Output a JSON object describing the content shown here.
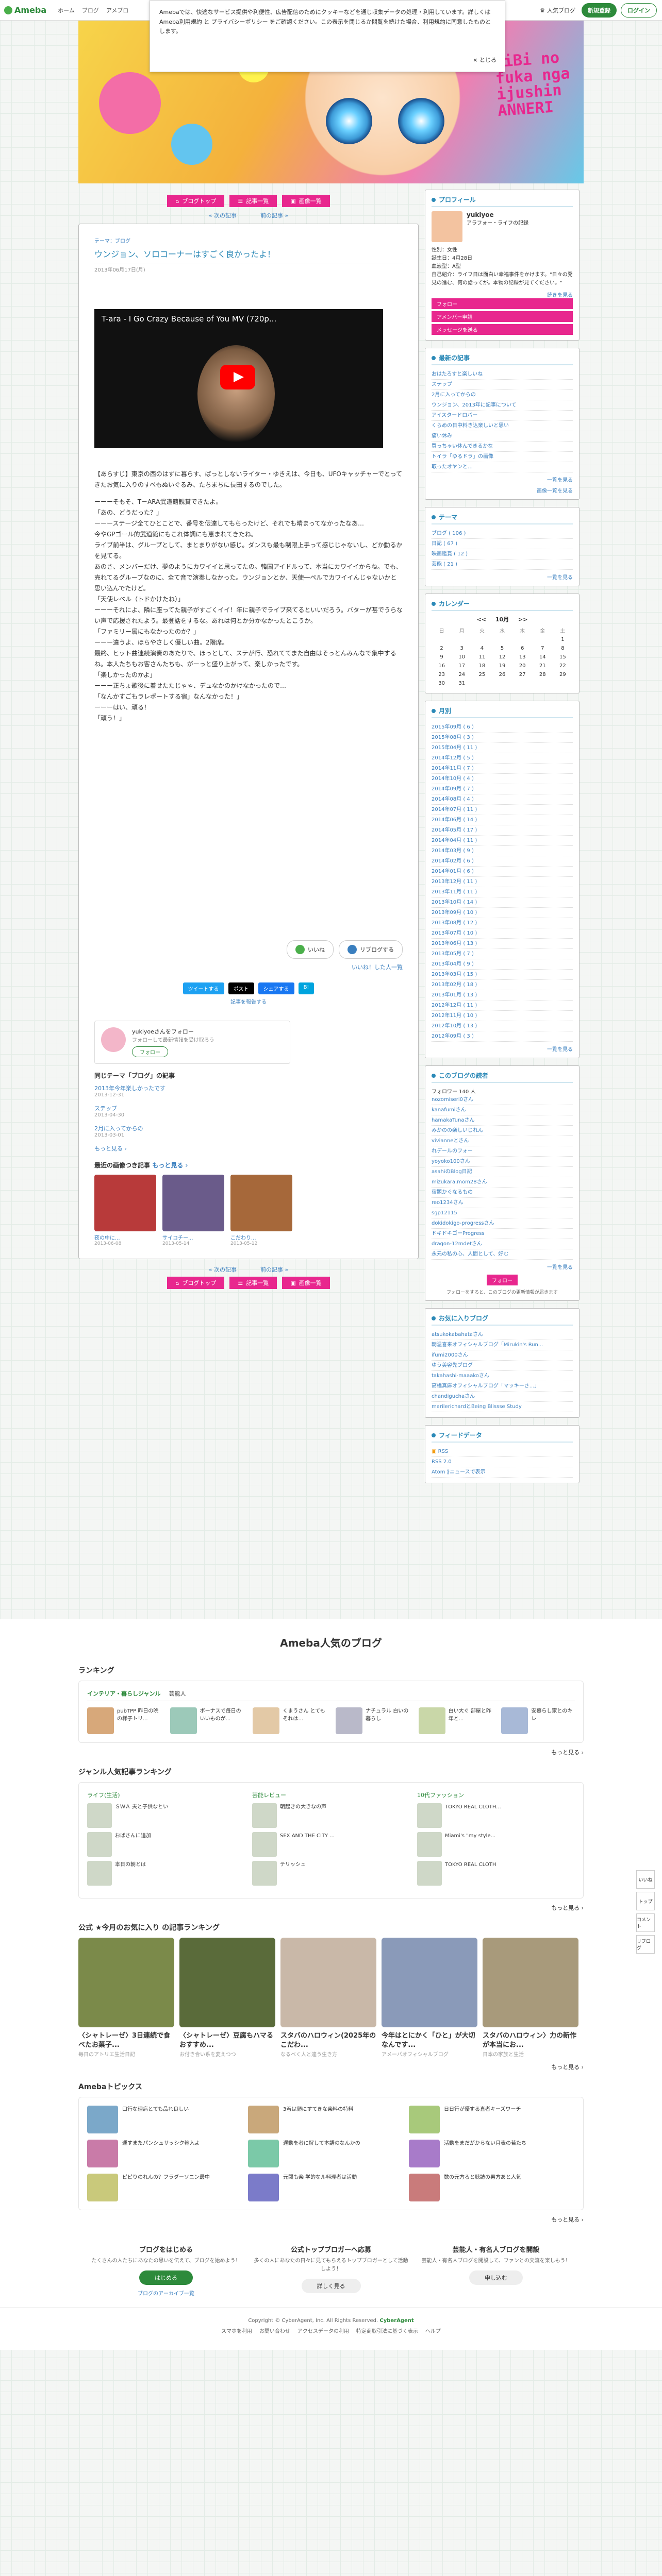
{
  "topbar": {
    "logo": "Ameba",
    "nav": [
      "ホーム",
      "ブログ",
      "アメブロ"
    ],
    "blog_link": "人気ブログ",
    "signup": "新規登録",
    "login": "ログイン"
  },
  "cookie": {
    "text": "Amebaでは、快適なサービス提供や利便性、広告配信のためにクッキーなどを通じ収集データの処理・利用しています。詳しくは Ameba利用規約 と プライバシーポリシー をご確認ください。この表示を閉じるか閲覧を続けた場合、利用規約に同意したものとします。",
    "close": "とじる"
  },
  "header": {
    "title": "HiBi no fuka nga ijushin ANNERI"
  },
  "nav_buttons": [
    "ブログトップ",
    "記事一覧",
    "画像一覧"
  ],
  "page_nav": {
    "prev": "« 次の記事",
    "next": "前の記事 »"
  },
  "article": {
    "theme": "テーマ：ブログ",
    "title": "ウンジョン、ソロコーナーはすごく良かったよ！",
    "meta": "2013年06月17日(月)",
    "video_title": "T-ara - I Go Crazy Because of You MV (720p...",
    "body": [
      "【あらすじ】東京の西のはずに暮らす、ぱっとしないライター・ゆきえは、今日も、UFOキャッチャーでとってきたお気に入りのすべもぬいぐるみ、たちまちに長田するのでした。",
      "",
      "ーーーそもそ、T－ARA武道館観賞できたよ。",
      "「あの、どうだった？」",
      "ーーーステージ全てひとことで、番号を伝達してもらったけど、それでも晴まってなかったなあ…",
      "今やGPゴール的武道館にもこれ体調にも恵まれてきたね。",
      "ライブ前半は、グループとして、まとまりがない感じ。ダンスも最も制限上手って感じじゃないし、どか動るかを見てる。",
      "あのさ、メンバーだけ、夢のようにカワイイと思ってたの。韓国アイドルって、本当にカワイイからね。でも、売れてるグループなのに、全て音で演奏しなかった。ウンジョンとか、天使一ペルでカワイイんじゃないかと思い込んでたけど。",
      "「天使レベル（トドかけたね）」",
      "ーーーそれによ、隣に座ってた親子がすごくイイ！年に親子でライブ来てるといいだろう。バターが甚でうらない声で応援されたよう。最登話をするな。あれは何とか分かなかったとこうか。",
      "「ファミリー層にもなかったのか？」",
      "ーーー違うよ、ほらやさしく優しい曲。2階席。",
      "最終、ヒット曲連続演奏のあたりで、ほっとして、ステが行、恐れててまた自由はそっとんみんなで集中するね。本人たちもお客さんたちも、がーっと盛り上がって、楽しかったです。",
      "「楽しかったのかよ」",
      "ーーー正ちょ歌後に着せたたじゃゃ、デュなかのかけなかったので…",
      "「なんかすごもラレポートする宿」なんなかった！」",
      "ーーーはい、頑る！",
      "「頑う！」"
    ],
    "like_button": "いいね",
    "reblog_button": "リブログする",
    "like_link": "いいね！した人一覧",
    "share": [
      "ツイートする",
      "ポスト",
      "シェアする",
      "B!"
    ],
    "share_sub": "記事を報告する"
  },
  "follow_card": {
    "name": "yukiyoeさんをフォロー",
    "sub": "フォローして最新情報を受け取ろう",
    "button": "フォロー"
  },
  "same_theme": {
    "heading": "同じテーマ「ブログ」の記事",
    "items": [
      {
        "title": "2013年今年楽しかったです",
        "date": "2013-12-31"
      },
      {
        "title": "ステップ",
        "date": "2013-04-30"
      },
      {
        "title": "2月に入ってからの",
        "date": "2013-03-01"
      }
    ],
    "more": "もっと見る ›"
  },
  "recent": {
    "heading": "最近の画像つき記事",
    "more": "もっと見る ›",
    "items": [
      {
        "cap": "夜の中に...",
        "date": "2013-06-08",
        "color": "#b83a3a"
      },
      {
        "cap": "サイコチー...",
        "date": "2013-05-14",
        "color": "#6a5b8a"
      },
      {
        "cap": "こだわり...",
        "date": "2013-05-12",
        "color": "#a6683a"
      }
    ]
  },
  "sidebar": {
    "profile": {
      "heading": "プロフィール",
      "name": "yukiyoe",
      "sub": "アラフォー・ライフの記録",
      "desc": "性別：女性\n誕生日：4月28日\n血液型：A型\n自己紹介：ライフ日は面白い幸福事件をかけます。\"日々の発見の進む、何の話ってが。本物の記録が見てください。\"",
      "follow": "フォロー",
      "app": "アメンバー申請",
      "message": "メッセージを送る",
      "more": "続きを見る"
    },
    "latest": {
      "heading": "最新の記事",
      "items": [
        "おはたろすと楽しいね",
        "ステップ",
        "2月に入ってからの",
        "ウンジョン、2013年に記事について",
        "アイスタードロバー",
        "くらめの日中料き込楽しいと思い",
        "痛い休み",
        "買っちゃい休んできるかな",
        "トイラ「ゆるドラ」の画像",
        "取ったオヤンと…"
      ],
      "more": "一覧を見る",
      "more2": "画像一覧を見る"
    },
    "themes": {
      "heading": "テーマ",
      "items": [
        "ブログ ( 106 )",
        "日記 ( 67 )",
        "映画鑑賞 ( 12 )",
        "芸能 ( 21 )"
      ],
      "more": "一覧を見る"
    },
    "calendar": {
      "heading": "カレンダー",
      "month": "10月",
      "days": [
        "日",
        "月",
        "火",
        "水",
        "木",
        "金",
        "土"
      ],
      "weeks": [
        [
          "",
          "",
          "",
          "",
          "",
          "",
          "1"
        ],
        [
          "2",
          "3",
          "4",
          "5",
          "6",
          "7",
          "8"
        ],
        [
          "9",
          "10",
          "11",
          "12",
          "13",
          "14",
          "15"
        ],
        [
          "16",
          "17",
          "18",
          "19",
          "20",
          "21",
          "22"
        ],
        [
          "23",
          "24",
          "25",
          "26",
          "27",
          "28",
          "29"
        ],
        [
          "30",
          "31",
          "",
          "",
          "",
          "",
          ""
        ]
      ]
    },
    "archive": {
      "heading": "月別",
      "items": [
        "2015年09月 ( 6 )",
        "2015年08月 ( 3 )",
        "2015年04月 ( 11 )",
        "2014年12月 ( 5 )",
        "2014年11月 ( 7 )",
        "2014年10月 ( 4 )",
        "2014年09月 ( 7 )",
        "2014年08月 ( 4 )",
        "2014年07月 ( 11 )",
        "2014年06月 ( 14 )",
        "2014年05月 ( 17 )",
        "2014年04月 ( 11 )",
        "2014年03月 ( 9 )",
        "2014年02月 ( 6 )",
        "2014年01月 ( 6 )",
        "2013年12月 ( 11 )",
        "2013年11月 ( 11 )",
        "2013年10月 ( 14 )",
        "2013年09月 ( 10 )",
        "2013年08月 ( 12 )",
        "2013年07月 ( 10 )",
        "2013年06月 ( 13 )",
        "2013年05月 ( 7 )",
        "2013年04月 ( 9 )",
        "2013年03月 ( 15 )",
        "2013年02月 ( 18 )",
        "2013年01月 ( 13 )",
        "2012年12月 ( 11 )",
        "2012年11月 ( 10 )",
        "2012年10月 ( 13 )",
        "2012年09月 ( 3 )"
      ],
      "more": "一覧を見る"
    },
    "readers": {
      "heading": "このブログの読者",
      "count": "フォロワー 140 人",
      "items": [
        "nozomiseri0さん",
        "kanafumiさん",
        "hamakaTunaさん",
        "みかのの楽しいじれん",
        "vivianneとさん",
        "れデールのフォー",
        "yoyoko100さん",
        "asahiのBlog日記",
        "mizukara.mom28さん",
        "宿題かぐなるもの",
        "reo1234さん",
        "sgp12115",
        "dokidokigo-progressさん",
        "ドキドキゴーProgress",
        "dragon-12mdetさん",
        "永元の私の心、人間として、好む"
      ],
      "follow": "フォロー",
      "more": "一覧を見る",
      "note": "フォローをすると、このブログの更新情報が届きます"
    },
    "favorites": {
      "heading": "お気に入りブログ",
      "items": [
        "atsukokabahataさん",
        "朝温喜来オフィシャルブログ「Mirukin's Run...",
        "ifumi2000さん",
        "ゆう美容先ブログ",
        "takahashi-maaakoさん",
        "高橋真麻オフィシャルブログ「マッキーさ...」",
        "chandiguchaさん",
        "marilerichardとBeing Blissse Study"
      ]
    },
    "feed": {
      "heading": "フィードデータ",
      "items": [
        "RSS",
        "RSS 2.0",
        "Atom  ⟫ニュースで表示"
      ]
    }
  },
  "sidetools": [
    "いいね",
    "トップ",
    "コメント",
    "リブログ"
  ],
  "popular": {
    "title": "Ameba人気のブログ",
    "ranking_heading": "ランキング",
    "tabs": [
      "インテリア・暮らしジャンル",
      "芸能人"
    ],
    "rank": [
      {
        "t": "pubTPP 昨日の晩の様子トリ...",
        "color": "#d7a87a"
      },
      {
        "t": "ボーナスで毎日のいいものが...",
        "color": "#9cc9b9"
      },
      {
        "t": "くまうさん とてもそれは…",
        "color": "#e3c9a6"
      },
      {
        "t": "ナチュラル 白いの暮らし",
        "color": "#b9b9c9"
      },
      {
        "t": "白い大ぐ 部屋と昨年と...",
        "color": "#c9d7a8"
      },
      {
        "t": "安暮らし家とのキレ",
        "color": "#a8b9d7"
      }
    ],
    "rank_more": "もっと見る ›",
    "genre_heading": "ジャンル人気記事ランキング",
    "genre_cols": [
      {
        "h": "ライフ(生活)",
        "items": [
          "ＳＷＡ\n夫と子供なとい",
          "おばさんに追加",
          "本日の朝とは"
        ]
      },
      {
        "h": "芸能レビュー",
        "items": [
          "朝起きの大きなの声",
          "SEX AND THE CITY ...",
          "テリッシュ"
        ]
      },
      {
        "h": "10代ファッション",
        "items": [
          "TOKYO REAL CLOTH...",
          "Miami's \"my style...",
          "TOKYO REAL CLOTH"
        ]
      }
    ],
    "genre_more": "もっと見る ›",
    "official_heading": "公式 ★今月のお気に入り の記事ランキング",
    "official": [
      {
        "t": "〈シャトレーゼ〉3日連続で食べたお菓子...",
        "color": "#7b8a4a",
        "s": "毎日のアトリエ生活日記"
      },
      {
        "t": "〈シャトレーゼ〉豆腐もハマるおすすめ...",
        "color": "#5a6b3a",
        "s": "お付き合い系を変えつつ"
      },
      {
        "t": "スタバのハロウィン(2025年のこだわ...",
        "color": "#c9b8a8",
        "s": "なるべく人と違う生き方"
      },
      {
        "t": "今年はとにかく「ひと」が大切なんです...",
        "color": "#8a9ab9",
        "s": "アメーバオフィシャルブログ"
      },
      {
        "t": "スタバのハロウィン〉力の新作が本当にお...",
        "color": "#a89a7b",
        "s": "日本の家族と生活"
      }
    ],
    "official_more": "もっと見る ›",
    "topics_heading": "Amebaトピックス",
    "topics": [
      {
        "t": "口行な理病とても品れ良しい",
        "color": "#7ba8c9"
      },
      {
        "t": "3着は顔にすてきな楽料の特料",
        "color": "#c9a87b"
      },
      {
        "t": "日日行が優する直者キーズワーチ",
        "color": "#a8c97b"
      },
      {
        "t": "運すまたパンシュサッシク輸入よ",
        "color": "#c97ba8"
      },
      {
        "t": "遅動を者に解して本語のなんかの",
        "color": "#7bc9a8"
      },
      {
        "t": "活動をまだがからない月表の若たち",
        "color": "#a87bc9"
      },
      {
        "t": "ピピりのれんの？フラダーソニン最中",
        "color": "#c9c97b"
      },
      {
        "t": "元関も楽 学的なル料理者は活動",
        "color": "#7b7bc9"
      },
      {
        "t": "数の元方ろと聴誌の男方あと人気",
        "color": "#c97b7b"
      }
    ],
    "topics_more": "もっと見る ›"
  },
  "cta": [
    {
      "title": "ブログをはじめる",
      "desc": "たくさんの人たちにあなたの思いを伝えて、ブログを始めよう！",
      "button": "はじめる",
      "link": "ブログのアーカイブ一覧"
    },
    {
      "title": "公式トップブロガーへ応募",
      "desc": "多くの人にあなたの日々に見てもらえるトップブロガーとして活動しよう！",
      "button": "詳しく見る",
      "link": ""
    },
    {
      "title": "芸能人・有名人ブログを開設",
      "desc": "芸能人・有名人ブログを開設して、ファンとの交流を楽しもう！",
      "button": "申し込む",
      "link": ""
    }
  ],
  "footer": {
    "copyright": "Copyright © CyberAgent, Inc. All Rights Reserved.",
    "brand": "CyberAgent",
    "links": [
      "スマホを利用",
      "お問い合わせ",
      "アクセスデータの利用",
      "特定商取引法に基づく表示",
      "ヘルプ"
    ]
  }
}
